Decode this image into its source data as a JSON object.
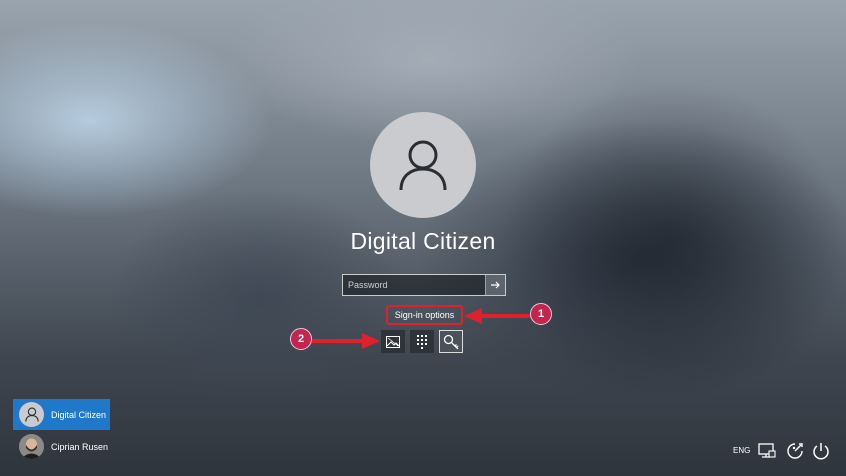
{
  "login": {
    "user_name": "Digital Citizen",
    "password_placeholder": "Password",
    "signin_options_label": "Sign-in options"
  },
  "signin_options": [
    {
      "icon": "picture-password-icon",
      "selected": false
    },
    {
      "icon": "pin-keypad-icon",
      "selected": false
    },
    {
      "icon": "security-key-icon",
      "selected": true
    }
  ],
  "annotations": {
    "badge_1": "1",
    "badge_2": "2",
    "color": "#c0264f",
    "highlight_color": "#e0202c"
  },
  "users": [
    {
      "name": "Digital Citizen",
      "active": true,
      "avatar": "default-user-icon"
    },
    {
      "name": "Ciprian Rusen",
      "active": false,
      "avatar": "user-photo"
    }
  ],
  "tray": {
    "language": "ENG",
    "icons": [
      "network-icon",
      "ease-of-access-icon",
      "power-icon"
    ]
  },
  "colors": {
    "active_user_tile": "#1f78c9"
  }
}
